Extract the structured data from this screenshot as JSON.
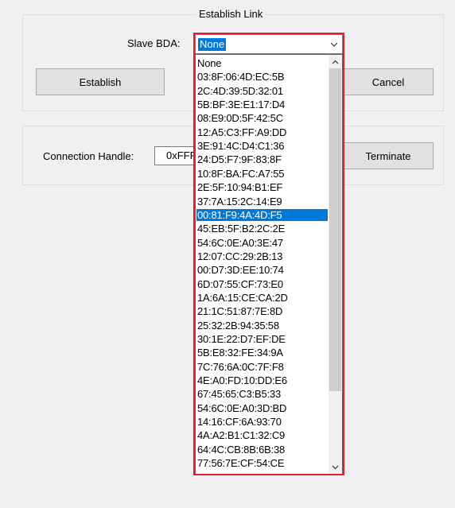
{
  "establish_group": {
    "title": "Establish Link",
    "slave_bda_label": "Slave BDA:",
    "slave_bda_value": "None",
    "establish_label": "Establish",
    "cancel_label": "Cancel"
  },
  "connection_group": {
    "handle_label": "Connection Handle:",
    "handle_value": "0xFFF",
    "terminate_label": "Terminate"
  },
  "dropdown": {
    "selected_value": "00:81:F9:4A:4D:F5",
    "options": [
      "None",
      "03:8F:06:4D:EC:5B",
      "2C:4D:39:5D:32:01",
      "5B:BF:3E:E1:17:D4",
      "08:E9:0D:5F:42:5C",
      "12:A5:C3:FF:A9:DD",
      "3E:91:4C:D4:C1:36",
      "24:D5:F7:9F:83:8F",
      "10:8F:BA:FC:A7:55",
      "2E:5F:10:94:B1:EF",
      "37:7A:15:2C:14:E9",
      "00:81:F9:4A:4D:F5",
      "45:EB:5F:B2:2C:2E",
      "54:6C:0E:A0:3E:47",
      "12:07:CC:29:2B:13",
      "00:D7:3D:EE:10:74",
      "6D:07:55:CF:73:E0",
      "1A:6A:15:CE:CA:2D",
      "21:1C:51:87:7E:8D",
      "25:32:2B:94:35:58",
      "30:1E:22:D7:EF:DE",
      "5B:E8:32:FE:34:9A",
      "7C:76:6A:0C:7F:F8",
      "4E:A0:FD:10:DD:E6",
      "67:45:65:C3:B5:33",
      "54:6C:0E:A0:3D:BD",
      "14:16:CF:6A:93:70",
      "4A:A2:B1:C1:32:C9",
      "64:4C:CB:8B:6B:38",
      "77:56:7E:CF:54:CE"
    ]
  },
  "colors": {
    "selection": "#0078d7",
    "highlight_border": "#e0202a"
  }
}
